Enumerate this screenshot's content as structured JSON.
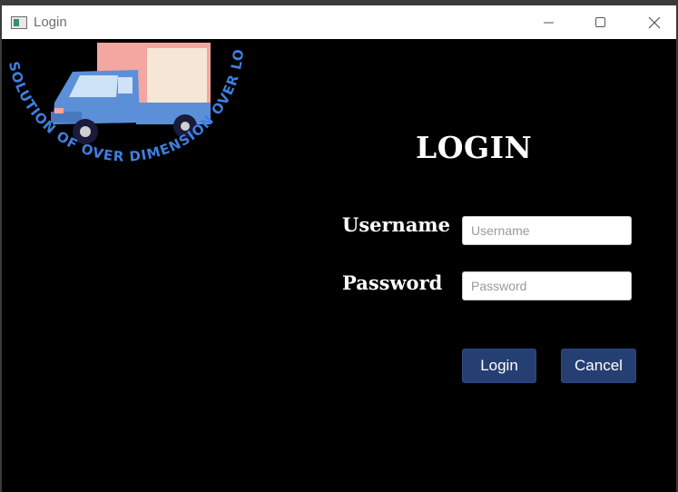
{
  "window": {
    "title": "Login",
    "controls": {
      "minimize_icon": "minimize-icon",
      "maximize_icon": "maximize-icon",
      "close_icon": "close-icon"
    }
  },
  "logo": {
    "arc_text": "SOLUTION OF OVER DIMENSION OVER LOAD",
    "image": "delivery-truck"
  },
  "form": {
    "heading": "LOGIN",
    "username_label": "Username",
    "username_placeholder": "Username",
    "username_value": "",
    "password_label": "Password",
    "password_placeholder": "Password",
    "password_value": "",
    "login_button": "Login",
    "cancel_button": "Cancel"
  },
  "colors": {
    "background": "#000000",
    "button": "#263f73",
    "logo_text": "#3f7fe0",
    "truck_body": "#5b8fd8",
    "truck_box": "#f3a7a0"
  }
}
